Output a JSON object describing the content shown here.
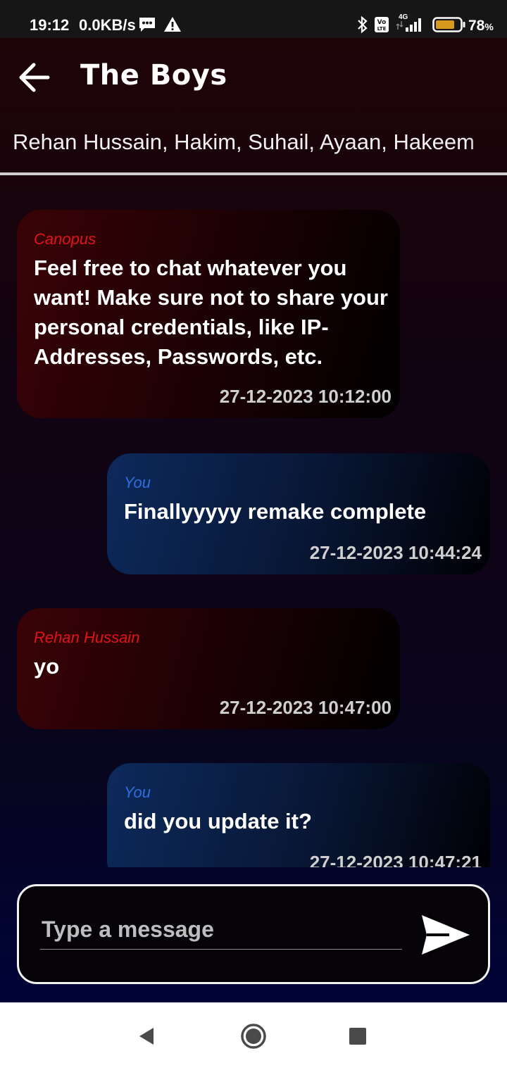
{
  "status_bar": {
    "time": "19:12",
    "net_speed": "0.0KB/s",
    "battery_level": "78",
    "battery_unit": "%",
    "network_type": "4G",
    "icons": [
      "message-icon",
      "warning-icon",
      "bluetooth-icon",
      "volte-icon",
      "signal-icon",
      "battery-icon"
    ]
  },
  "header": {
    "title": "The Boys",
    "members": "Rehan Hussain, Hakim, Suhail, Ayaan, Hakeem"
  },
  "messages": [
    {
      "sender": "Canopus",
      "text": "Feel free to chat whatever you want! Make sure not to share your personal credentials, like IP-Addresses, Passwords, etc.",
      "time": "27-12-2023 10:12:00",
      "direction": "received"
    },
    {
      "sender": "You",
      "text": "Finallyyyyy remake complete",
      "time": "27-12-2023 10:44:24",
      "direction": "sent"
    },
    {
      "sender": "Rehan Hussain",
      "text": "yo",
      "time": "27-12-2023 10:47:00",
      "direction": "received"
    },
    {
      "sender": "You",
      "text": "did you update it?",
      "time": "27-12-2023 10:47:21",
      "direction": "sent"
    }
  ],
  "composer": {
    "placeholder": "Type a message",
    "value": ""
  },
  "colors": {
    "received_sender": "#e2121a",
    "sent_sender": "#2f6ee0",
    "timestamp": "#cfcfcf",
    "composer_border": "#f2f2f2"
  }
}
